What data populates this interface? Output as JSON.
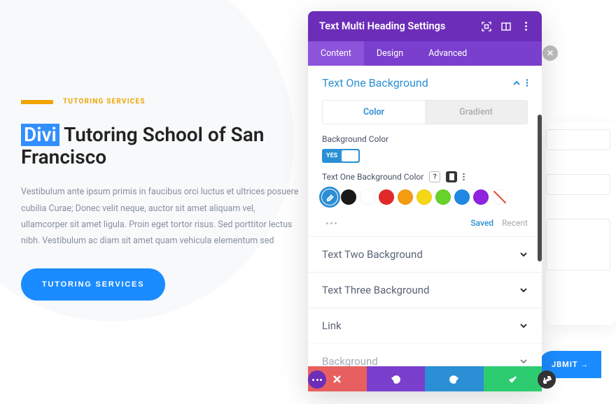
{
  "hero": {
    "eyebrow": "TUTORING SERVICES",
    "title_highlighted": "Divi",
    "title_rest": " Tutoring School of San Francisco",
    "body": "Vestibulum ante ipsum primis in faucibus orci luctus et ultrices posuere cubilia Curae; Donec velit neque, auctor sit amet aliquam vel, ullamcorper sit amet ligula. Proin eget tortor risus. Sed porttitor lectus nibh. Vestibulum ac diam sit amet quam vehicula elementum sed",
    "cta_label": "TUTORING SERVICES"
  },
  "panel": {
    "title": "Text Multi Heading Settings",
    "tabs": {
      "content": "Content",
      "design": "Design",
      "advanced": "Advanced",
      "active": "content"
    },
    "section_active_title": "Text One Background",
    "sub_tabs": {
      "color": "Color",
      "gradient": "Gradient"
    },
    "bg_color_field_label": "Background Color",
    "toggle_value": "YES",
    "color_field_label": "Text One Background Color",
    "swatches": [
      "#2a8fd5",
      "#1a1a1a",
      "#ffffff",
      "#e12929",
      "#f39c12",
      "#f4d716",
      "#67d22a",
      "#1e88e5",
      "#8e24e0"
    ],
    "saved_label": "Saved",
    "recent_label": "Recent",
    "collapsed": [
      "Text Two Background",
      "Text Three Background",
      "Link",
      "Background"
    ]
  },
  "submit_label": "JBMIT →"
}
